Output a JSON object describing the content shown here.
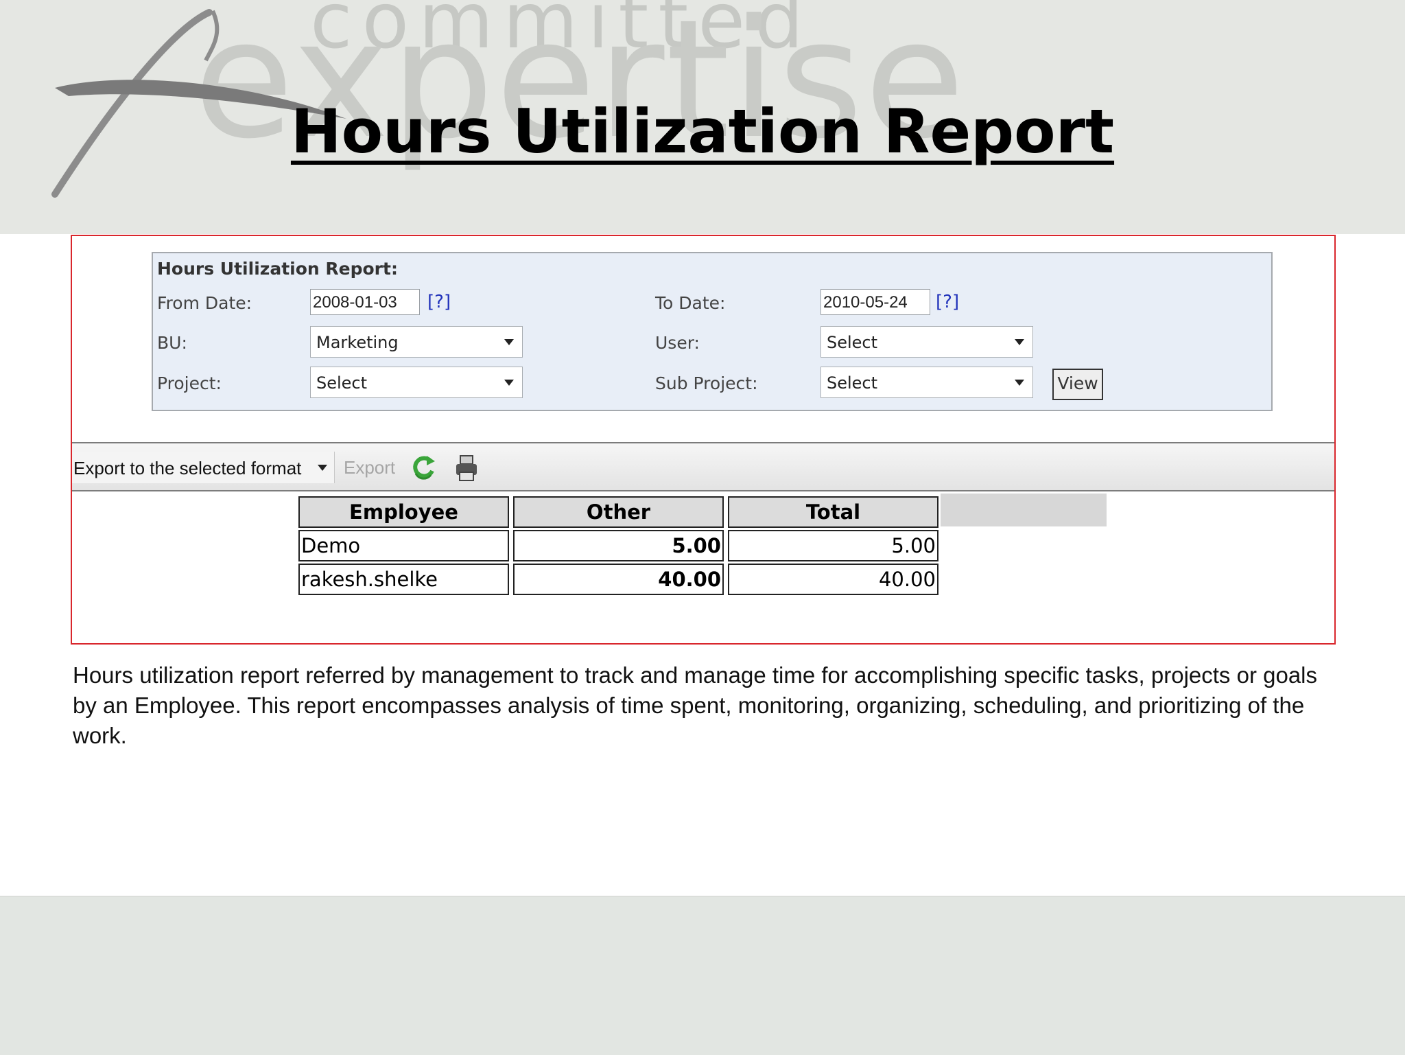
{
  "watermark": {
    "line1": "committed",
    "line2": "expertise"
  },
  "slide_title": "Hours Utilization Report",
  "filters": {
    "heading": "Hours Utilization Report:",
    "from_date_label": "From Date:",
    "from_date_value": "2008-01-03",
    "to_date_label": "To Date:",
    "to_date_value": "2010-05-24",
    "help_text": "[?]",
    "bu_label": "BU:",
    "bu_value": "Marketing",
    "user_label": "User:",
    "user_value": "Select",
    "project_label": "Project:",
    "project_value": "Select",
    "subproject_label": "Sub Project:",
    "subproject_value": "Select",
    "view_label": "View"
  },
  "toolbar": {
    "export_format": "Export to the selected format",
    "export_label": "Export",
    "refresh_icon": "refresh-icon",
    "print_icon": "print-icon"
  },
  "table": {
    "headers": [
      "Employee",
      "Other",
      "Total"
    ],
    "rows": [
      {
        "employee": "Demo",
        "other": "5.00",
        "total": "5.00"
      },
      {
        "employee": "rakesh.shelke",
        "other": "40.00",
        "total": "40.00"
      }
    ]
  },
  "description": "Hours utilization report referred by management to track and manage time for accomplishing specific tasks, projects or goals by an Employee. This report encompasses analysis of time spent, monitoring, organizing, scheduling, and prioritizing of the work.",
  "colors": {
    "frame_border": "#d9262c",
    "filter_bg": "#e8eef7",
    "help_link": "#2233bb",
    "header_band": "#e5e7e3"
  }
}
